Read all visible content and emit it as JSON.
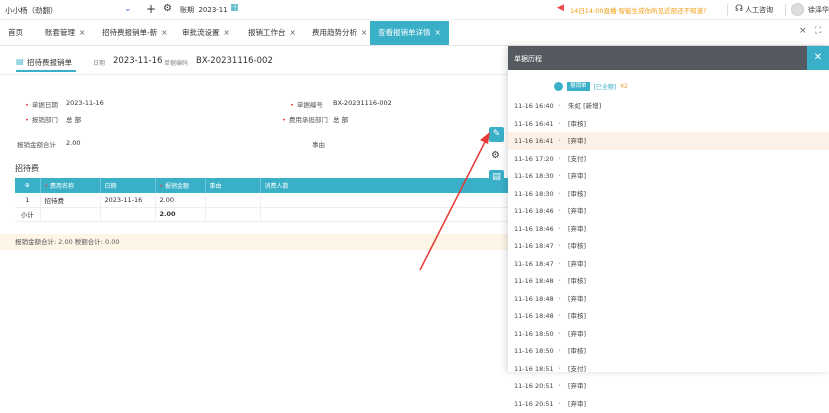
{
  "topbar": {
    "company": "小小杨（劲翻）",
    "period_label": "账期",
    "period_value": "2023-11",
    "notice": "14日14:00直播·智能生成你所见近部还不知道?",
    "support": "人工咨询",
    "user": "徐泽华"
  },
  "tabs": [
    {
      "label": "首页",
      "closable": false
    },
    {
      "label": "账套管理",
      "closable": true
    },
    {
      "label": "招待费报销单-新",
      "closable": true
    },
    {
      "label": "审批流设置",
      "closable": true
    },
    {
      "label": "报销工作台",
      "closable": true
    },
    {
      "label": "费用趋势分析",
      "closable": true
    },
    {
      "label": "查看报销单详情",
      "closable": true,
      "active": true
    }
  ],
  "doc": {
    "type_label": "招待费报销单",
    "date_label": "日期",
    "date_value": "2023-11-16",
    "no_label": "单据编码",
    "no_value": "BX-20231116-002"
  },
  "form": {
    "doc_date_label": "单据日期",
    "doc_date_value": "2023-11-16",
    "doc_no_label": "单据编号",
    "doc_no_value": "BX-20231116-002",
    "dept_label": "报销部门",
    "dept_value": "总 部",
    "cost_dept_label": "费用承担部门",
    "cost_dept_value": "总 部",
    "total_label": "报销金额合计",
    "total_value": "2.00",
    "reason_label": "事由"
  },
  "section": {
    "title": "招待费"
  },
  "table": {
    "headers": [
      "",
      "费用名称",
      "日期",
      "报销金额",
      "事由",
      "消费人数"
    ],
    "rows": [
      [
        "1",
        "招待费",
        "2023-11-16",
        "2.00",
        "",
        ""
      ]
    ],
    "subtotal_label": "小计",
    "subtotal_value": "2.00"
  },
  "totals_bar": "报销金额合计: 2.00    税额合计: 0.00",
  "panel": {
    "title": "单据历程",
    "badge": "报销单",
    "status": "[已全额]",
    "amount": "¥2",
    "history": [
      {
        "time": "11-16 16:40",
        "action": "朱虹 [新增]"
      },
      {
        "time": "11-16 16:41",
        "action": "[审核]"
      },
      {
        "time": "11-16 16:41",
        "action": "[弃审]",
        "highlight": true
      },
      {
        "time": "11-16 17:20",
        "action": "[支付]"
      },
      {
        "time": "11-16 18:30",
        "action": "[弃审]"
      },
      {
        "time": "11-16 18:30",
        "action": "[审核]"
      },
      {
        "time": "11-16 18:46",
        "action": "[弃审]"
      },
      {
        "time": "11-16 18:46",
        "action": "[弃审]"
      },
      {
        "time": "11-16 18:47",
        "action": "[审核]"
      },
      {
        "time": "11-16 18:47",
        "action": "[弃审]"
      },
      {
        "time": "11-16 18:48",
        "action": "[审核]"
      },
      {
        "time": "11-16 18:48",
        "action": "[弃审]"
      },
      {
        "time": "11-16 18:48",
        "action": "[审核]"
      },
      {
        "time": "11-16 18:50",
        "action": "[弃审]"
      },
      {
        "time": "11-16 18:50",
        "action": "[审核]"
      },
      {
        "time": "11-16 18:51",
        "action": "[支付]"
      },
      {
        "time": "11-16 20:51",
        "action": "[弃审]"
      },
      {
        "time": "11-16 20:51",
        "action": "[弃审]"
      }
    ]
  },
  "colors": {
    "accent": "#3ab0c8",
    "panel_header": "#555a60",
    "arrow": "#e53935"
  }
}
